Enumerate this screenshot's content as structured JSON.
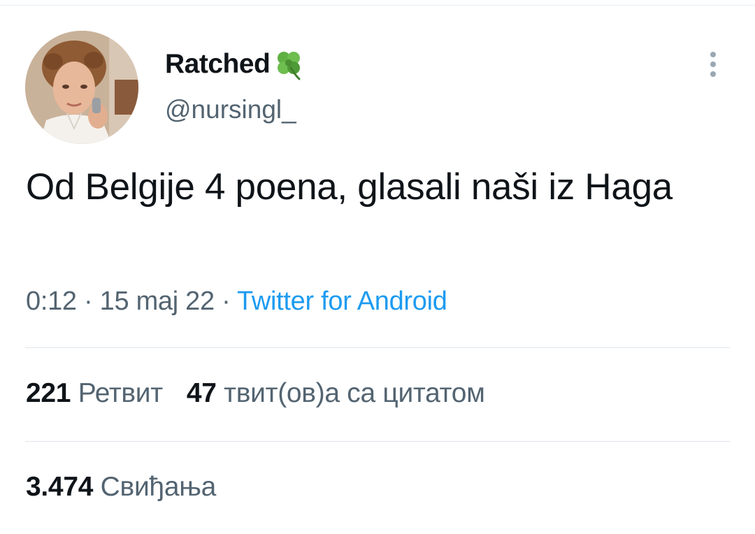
{
  "author": {
    "display_name": "Ratched",
    "name_emoji": "four-leaf-clover-icon",
    "handle": "@nursingl_",
    "avatar": "avatar-photo"
  },
  "tweet": {
    "text": "Od Belgije 4 poena, glasali naši iz Haga"
  },
  "meta": {
    "time": "0:12",
    "separator": "·",
    "date": "15 maj 22",
    "source": "Twitter for Android"
  },
  "stats": {
    "retweets_count": "221",
    "retweets_label": "Ретвит",
    "quotes_count": "47",
    "quotes_label": "твит(ов)а са цитатом",
    "likes_count": "3.474",
    "likes_label": "Свиђања"
  },
  "colors": {
    "text_primary": "#0f1419",
    "text_secondary": "#536471",
    "link": "#1d9bf0",
    "divider": "#dfe5ea"
  }
}
